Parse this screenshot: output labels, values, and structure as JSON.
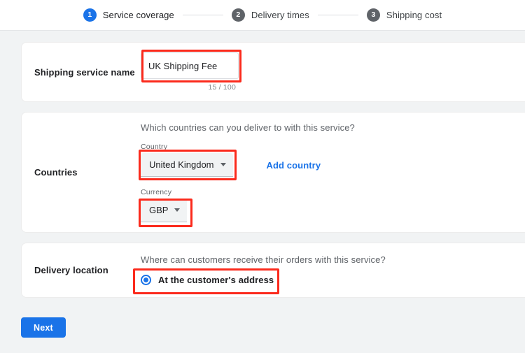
{
  "stepper": {
    "steps": [
      {
        "number": "1",
        "label": "Service coverage",
        "state": "active"
      },
      {
        "number": "2",
        "label": "Delivery times",
        "state": "inactive"
      },
      {
        "number": "3",
        "label": "Shipping cost",
        "state": "inactive"
      }
    ]
  },
  "service_name": {
    "label": "Shipping service name",
    "value": "UK Shipping Fee",
    "placeholder": "",
    "counter": "15 / 100"
  },
  "countries": {
    "label": "Countries",
    "question": "Which countries can you deliver to with this service?",
    "country_field_label": "Country",
    "country_value": "United Kingdom",
    "add_country_link": "Add country",
    "currency_field_label": "Currency",
    "currency_value": "GBP"
  },
  "delivery_location": {
    "label": "Delivery location",
    "question": "Where can customers receive their orders with this service?",
    "option_label": "At the customer's address"
  },
  "footer": {
    "next_label": "Next"
  },
  "colors": {
    "accent": "#1a73e8",
    "step_inactive": "#5f6368",
    "annotation": "#fb2a1c",
    "page_bg": "#f1f3f4",
    "card_bg": "#ffffff"
  },
  "icons": {
    "caret": "chevron-down-icon",
    "radio": "radio-selected-icon"
  }
}
